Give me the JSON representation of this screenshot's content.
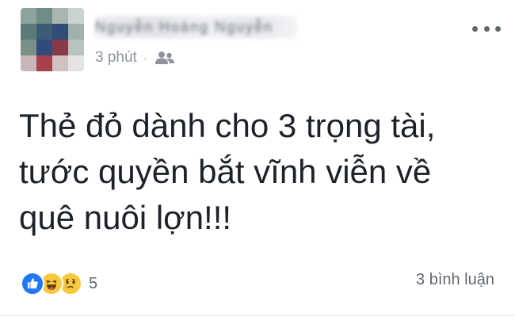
{
  "post": {
    "author": {
      "name": "Nguyễn Hoàng Nguyễn"
    },
    "meta": {
      "time": "3 phút",
      "separator": "·",
      "audience_icon": "friends-icon"
    },
    "text_lines": [
      "Thẻ đỏ dành cho 3 trọng tài,",
      "tước quyền bắt vĩnh viễn về",
      "quê nuôi lợn!!!"
    ],
    "reactions": {
      "icons": [
        "like-icon",
        "haha-icon",
        "sad-icon"
      ],
      "count": "5"
    },
    "comments": {
      "label": "3 bình luận"
    }
  },
  "colors": {
    "text": "#1d2129",
    "meta": "#8d949e",
    "like_blue": "#2078f4",
    "emoji_yellow": "#f7c93d"
  }
}
